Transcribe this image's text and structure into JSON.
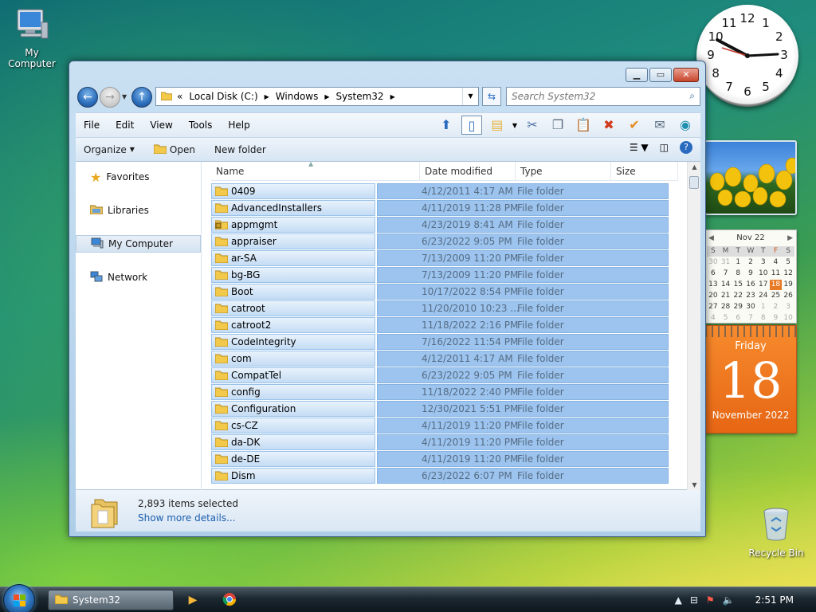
{
  "desktop": {
    "my_computer_label": "My Computer",
    "recycle_bin_label": "Recycle Bin"
  },
  "clock": {
    "numbers": [
      "12",
      "1",
      "2",
      "3",
      "4",
      "5",
      "6",
      "7",
      "8",
      "9",
      "10",
      "11"
    ],
    "time": "2:51"
  },
  "calendar": {
    "month_label": "Nov 22",
    "weekdays": [
      "S",
      "M",
      "T",
      "W",
      "T",
      "F",
      "S"
    ],
    "day_name": "Friday",
    "day_number": "18",
    "month_year": "November 2022",
    "grid": [
      [
        "30",
        "31",
        "1",
        "2",
        "3",
        "4",
        "5"
      ],
      [
        "6",
        "7",
        "8",
        "9",
        "10",
        "11",
        "12"
      ],
      [
        "13",
        "14",
        "15",
        "16",
        "17",
        "18",
        "19"
      ],
      [
        "20",
        "21",
        "22",
        "23",
        "24",
        "25",
        "26"
      ],
      [
        "27",
        "28",
        "29",
        "30",
        "1",
        "2",
        "3"
      ],
      [
        "4",
        "5",
        "6",
        "7",
        "8",
        "9",
        "10"
      ]
    ]
  },
  "window": {
    "address": {
      "root": "«",
      "segments": [
        "Local Disk (C:)",
        "Windows",
        "System32"
      ]
    },
    "search": {
      "placeholder": "Search System32"
    },
    "menu": [
      "File",
      "Edit",
      "View",
      "Tools",
      "Help"
    ],
    "commands": {
      "organize": "Organize",
      "open": "Open",
      "new_folder": "New folder"
    },
    "nav": [
      "Favorites",
      "Libraries",
      "My Computer",
      "Network"
    ],
    "columns": {
      "name": "Name",
      "date": "Date modified",
      "type": "Type",
      "size": "Size"
    },
    "files": [
      {
        "name": "0409",
        "date": "4/12/2011 4:17 AM",
        "type": "File folder",
        "locked": false
      },
      {
        "name": "AdvancedInstallers",
        "date": "4/11/2019 11:28 PM",
        "type": "File folder",
        "locked": false
      },
      {
        "name": "appmgmt",
        "date": "4/23/2019 8:41 AM",
        "type": "File folder",
        "locked": true
      },
      {
        "name": "appraiser",
        "date": "6/23/2022 9:05 PM",
        "type": "File folder",
        "locked": false
      },
      {
        "name": "ar-SA",
        "date": "7/13/2009 11:20 PM",
        "type": "File folder",
        "locked": false
      },
      {
        "name": "bg-BG",
        "date": "7/13/2009 11:20 PM",
        "type": "File folder",
        "locked": false
      },
      {
        "name": "Boot",
        "date": "10/17/2022 8:54 PM",
        "type": "File folder",
        "locked": false
      },
      {
        "name": "catroot",
        "date": "11/20/2010 10:23 ...",
        "type": "File folder",
        "locked": false
      },
      {
        "name": "catroot2",
        "date": "11/18/2022 2:16 PM",
        "type": "File folder",
        "locked": false
      },
      {
        "name": "CodeIntegrity",
        "date": "7/16/2022 11:54 PM",
        "type": "File folder",
        "locked": false
      },
      {
        "name": "com",
        "date": "4/12/2011 4:17 AM",
        "type": "File folder",
        "locked": false
      },
      {
        "name": "CompatTel",
        "date": "6/23/2022 9:05 PM",
        "type": "File folder",
        "locked": false
      },
      {
        "name": "config",
        "date": "11/18/2022 2:40 PM",
        "type": "File folder",
        "locked": false
      },
      {
        "name": "Configuration",
        "date": "12/30/2021 5:51 PM",
        "type": "File folder",
        "locked": false
      },
      {
        "name": "cs-CZ",
        "date": "4/11/2019 11:20 PM",
        "type": "File folder",
        "locked": false
      },
      {
        "name": "da-DK",
        "date": "4/11/2019 11:20 PM",
        "type": "File folder",
        "locked": false
      },
      {
        "name": "de-DE",
        "date": "4/11/2019 11:20 PM",
        "type": "File folder",
        "locked": false
      },
      {
        "name": "Dism",
        "date": "6/23/2022 6:07 PM",
        "type": "File folder",
        "locked": false
      }
    ],
    "details": {
      "count": "2,893 items selected",
      "more": "Show more details..."
    }
  },
  "taskbar": {
    "task_label": "System32",
    "time": "2:51 PM"
  },
  "colors": {
    "accent": "#1c5fae",
    "selection": "#9cc4ee",
    "today": "#e87a26"
  }
}
